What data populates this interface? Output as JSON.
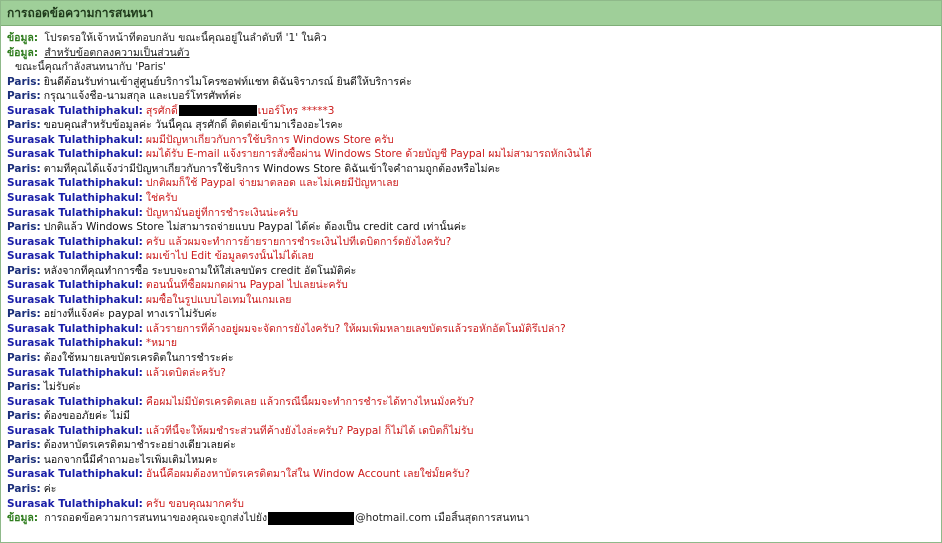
{
  "window": {
    "title": "การถอดข้อความการสนทนา"
  },
  "colors": {
    "header_bg": "#9fcf99",
    "system_label": "#2f7d1e",
    "paris_name": "#1b2f7a",
    "agent_name": "#1a1fa8",
    "agent_text": "#cc1b1b"
  },
  "transcript": {
    "sys1": {
      "label": "ข้อมูล:",
      "text": "โปรดรอให้เจ้าหน้าที่ตอบกลับ   ขณะนี้คุณอยู่ในลำดับที่ '1' ในคิว"
    },
    "sys2": {
      "label": "ข้อมูล:",
      "text": "สำหรับข้อตกลงความเป็นส่วนตัว"
    },
    "sys3": {
      "text": "ขณะนี้คุณกำลังสนทนากับ 'Paris'"
    },
    "m1": {
      "name": "Paris:",
      "text": "ยินดีต้อนรับท่านเข้าสู่ศูนย์บริการไมโครซอฟท์แชท ดิฉันจิราภรณ์ ยินดีให้บริการค่ะ"
    },
    "m2": {
      "name": "Paris:",
      "text": "กรุณาแจ้งชื่อ-นามสกุล และเบอร์โทรศัพท์ค่ะ"
    },
    "m3": {
      "name": "Surasak Tulathiphakul:",
      "text_a": "สุรศักดิ์",
      "text_b": "เบอร์โทร *****3"
    },
    "m4": {
      "name": "Paris:",
      "text": "ขอบคุณสำหรับข้อมูลค่ะ วันนี้คุณ สุรศักดิ์ ติดต่อเข้ามาเรื่องอะไรคะ"
    },
    "m5": {
      "name": "Surasak Tulathiphakul:",
      "text": "ผมมีปัญหาเกี่ยวกับการใช้บริการ Windows Store ครับ"
    },
    "m6": {
      "name": "Surasak Tulathiphakul:",
      "text": "ผมได้รับ E-mail แจ้งรายการสั่งซื้อผ่าน Windows Store ด้วยบัญชี Paypal ผมไม่สามารถหักเงินได้"
    },
    "m7": {
      "name": "Paris:",
      "text": "ตามที่คุณได้แจ้งว่ามีปัญหาเกี่ยวกับการใช้บริการ Windows Store  ดิฉันเข้าใจคำถามถูกต้องหรือไม่คะ"
    },
    "m8": {
      "name": "Surasak Tulathiphakul:",
      "text": "ปกติผมก็ใช้ Paypal จ่ายมาตลอด และไม่เคยมีปัญหาเลย"
    },
    "m9": {
      "name": "Surasak Tulathiphakul:",
      "text": "ใช่ครับ"
    },
    "m10": {
      "name": "Surasak Tulathiphakul:",
      "text": "ปัญหามันอยู่ที่การชำระเงินน่ะครับ"
    },
    "m11": {
      "name": "Paris:",
      "text": "ปกติแล้ว Windows Store ไม่สามารถจ่ายแบบ Paypal ได้ค่ะ ต้องเป็น credit card เท่านั้นค่ะ"
    },
    "m12": {
      "name": "Surasak Tulathiphakul:",
      "text": "ครับ แล้วผมจะทำการย้ายรายการชำระเงินไปที่เดบิตการ์ดยังไงครับ?"
    },
    "m13": {
      "name": "Surasak Tulathiphakul:",
      "text": "ผมเข้าไป Edit ข้อมูลตรงนั้นไม่ได้เลย"
    },
    "m14": {
      "name": "Paris:",
      "text": "หลังจากที่คุณทำการซื้อ ระบบจะถามให้ใส่เลขบัตร credit อัตโนมัติค่ะ"
    },
    "m15": {
      "name": "Surasak Tulathiphakul:",
      "text": "ตอนนั้นที่ซื้อผมกดผ่าน Paypal ไปเลยน่ะครับ"
    },
    "m16": {
      "name": "Surasak Tulathiphakul:",
      "text": "ผมซื้อในรูปแบบไอเทมในเกมเลย"
    },
    "m17": {
      "name": "Paris:",
      "text": "อย่างที่แจ้งค่ะ paypal ทางเราไม่รับค่ะ"
    },
    "m18": {
      "name": "Surasak Tulathiphakul:",
      "text": "แล้วรายการที่ค้างอยู่ผมจะจัดการยังไงครับ? ให้ผมเพิ่มหลายเลขบัตรแล้วรอหักอัตโนมัติรึเปล่า?"
    },
    "m19": {
      "name": "Surasak Tulathiphakul:",
      "text": "*หมาย"
    },
    "m20": {
      "name": "Paris:",
      "text": "ต้องใช้หมายเลขบัตรเครดิตในการชำระค่ะ"
    },
    "m21": {
      "name": "Surasak Tulathiphakul:",
      "text": "แล้วเดบิตล่ะครับ?"
    },
    "m22": {
      "name": "Paris:",
      "text": "ไม่รับค่ะ"
    },
    "m23": {
      "name": "Surasak Tulathiphakul:",
      "text": "คือผมไม่มีบัตรเครดิตเลย แล้วกรณีนี้ผมจะทำการชำระได้ทางไหนมั่งครับ?"
    },
    "m24": {
      "name": "Paris:",
      "text": "ต้องขออภัยค่ะ ไม่มี"
    },
    "m25": {
      "name": "Surasak Tulathiphakul:",
      "text": "แล้วที่นี้จะให้ผมชำระส่วนที่ค้างยังไงล่ะครับ? Paypal ก็ไม่ได้ เดบิตก็ไม่รับ"
    },
    "m26": {
      "name": "Paris:",
      "text": "ต้องหาบัตรเครดิตมาชำระอย่างเดียวเลยค่ะ"
    },
    "m27": {
      "name": "Paris:",
      "text": "นอกจากนี้มีคำถามอะไรเพิ่มเติมไหมคะ"
    },
    "m28": {
      "name": "Surasak Tulathiphakul:",
      "text": "อันนี้คือผมต้องหาบัตรเครดิตมาใส่ใน Window Account เลยใช่มั้ยครับ?"
    },
    "m29": {
      "name": "Paris:",
      "text": "ค่ะ"
    },
    "m30": {
      "name": "Surasak Tulathiphakul:",
      "text": "ครับ ขอบคุณมากครับ"
    },
    "sys4": {
      "label": "ข้อมูล:",
      "text_a": "การถอดข้อความการสนทนาของคุณจะถูกส่งไปยัง",
      "text_b": "@hotmail.com เมื่อสิ้นสุดการสนทนา"
    }
  }
}
